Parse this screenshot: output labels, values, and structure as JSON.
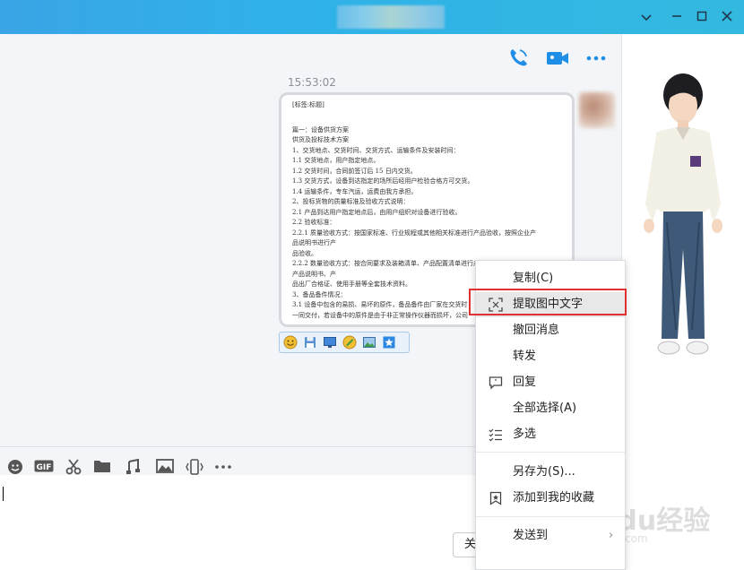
{
  "window": {
    "controls": {
      "collapse_icon": "chevron-down-icon",
      "minimize_icon": "minimize-icon",
      "maximize_icon": "maximize-icon",
      "close_icon": "close-icon"
    }
  },
  "header_actions": {
    "call_icon": "phone-icon",
    "video_icon": "video-icon",
    "more_icon": "more-icon"
  },
  "chat": {
    "timestamp": "15:53:02",
    "document": {
      "tag": "[标签:标题]",
      "lines": [
        "篇一：设备供货方案",
        "  供货及投标技术方案",
        "   1、交货地点、交货时间、交货方式、运输条件及安装时间：",
        "  1.1  交货地点，用户指定地点。",
        "  1.2  交货时间，合同前签订后 15 日内交货。",
        "  1.3  交货方式，设备到达指定的场所后经用户检验合格方可交货。",
        "  1.4  运输条件，专车汽运，运费由我方承担。",
        "  2、投标货物的质量标准及验收方式说明：",
        "  2.1    产品到达用户指定地点后，由用户组织对设备进行验收。",
        "  2.2    验收标准：",
        "  2.2.1  质量验收方式：按国家标准、行业规程或其他相关标准进行产品验收，按照企业产",
        "品说明书进行产",
        "  品验收。",
        "  2.2.2  数量验收方式：按合同要求及装箱清单、产品配置清单进行产品验收，按照企业",
        "产品说明书、产",
        "  品出厂合格证、使用手册等全套技术资料。",
        "  3、备品备件情况：",
        "  3.1  设备中包含的易损、易坏的原件，备品备件由厂家在交货时",
        "一同交付，若设备中的原件是由于非正常操作仪器而损坏，公司"
      ]
    },
    "image_toolbar": [
      "emoji-sticker-icon",
      "save-icon",
      "screen-icon",
      "edit-icon",
      "image-edit-icon",
      "favorite-icon"
    ]
  },
  "input_toolbar": [
    "emoji-icon",
    "gif-icon",
    "scissors-icon",
    "folder-icon",
    "music-icon",
    "image-icon",
    "shake-icon",
    "more-icon"
  ],
  "buttons": {
    "close": "关闭(C)"
  },
  "context_menu": {
    "items": [
      {
        "label": "复制(C)",
        "icon": ""
      },
      {
        "label": "提取图中文字",
        "icon": "scan-text-icon",
        "highlighted": true
      },
      {
        "label": "撤回消息",
        "icon": ""
      },
      {
        "label": "转发",
        "icon": ""
      },
      {
        "label": "回复",
        "icon": "reply-icon"
      },
      {
        "label": "全部选择(A)",
        "icon": ""
      },
      {
        "label": "多选",
        "icon": "multi-select-icon"
      },
      {
        "label": "另存为(S)...",
        "icon": ""
      },
      {
        "label": "添加到我的收藏",
        "icon": "bookmark-icon"
      },
      {
        "label": "发送到",
        "icon": ""
      }
    ],
    "highlight_color": "#e03131"
  },
  "watermark": {
    "text": "Baidu经验",
    "sub": "jingyan.baidu.com"
  }
}
